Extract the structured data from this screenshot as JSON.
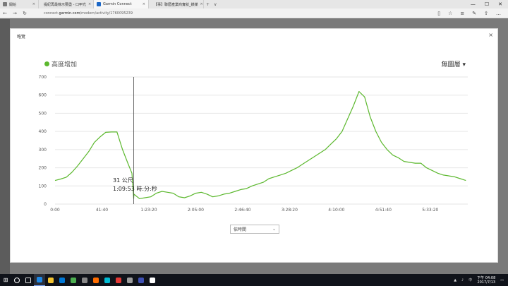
{
  "browser": {
    "tabs": [
      {
        "title": "開始",
        "color": "#7a7a7a",
        "active": false
      },
      {
        "title": "提紀再最條示要盡 - 口甲光",
        "color": "#2e9d4b",
        "active": false
      },
      {
        "title": "Garmin Connect",
        "color": "#1b67c7",
        "active": true
      },
      {
        "title": "【事】聯歷產業商實就_媒媒",
        "color": "#d9232a",
        "active": false
      }
    ],
    "new_tab": "+",
    "tab_menu": "∨",
    "url_prefix": "connect.",
    "url_domain": "garmin.com",
    "url_path": "/modern/activity/1760095239"
  },
  "modal": {
    "title": "略覽",
    "close": "×",
    "legend_label": "高度增加",
    "overlay_dropdown": "無圖層 ▾",
    "tooltip_distance": "31 公尺",
    "tooltip_time": "1:09:53 時:分:秒",
    "select_value": "依時間"
  },
  "chart_data": {
    "type": "line",
    "series": [
      {
        "name": "高度增加",
        "color": "#5cb82e",
        "x": [
          0,
          300,
          600,
          900,
          1200,
          1500,
          1800,
          2100,
          2400,
          2700,
          3000,
          3300,
          3600,
          3900,
          4100,
          4193,
          4200,
          4500,
          4800,
          5100,
          5400,
          5700,
          6000,
          6300,
          6600,
          6900,
          7200,
          7500,
          7800,
          8100,
          8400,
          8700,
          9000,
          9300,
          9600,
          9900,
          10200,
          10500,
          10800,
          11100,
          11400,
          11700,
          12000,
          12300,
          12600,
          12900,
          13200,
          13500,
          13800,
          14100,
          14400,
          14700,
          15000,
          15300,
          15600,
          15900,
          16200,
          16500,
          16800,
          17100,
          17400,
          17700,
          18000,
          18300,
          18600,
          18900,
          19200,
          19500,
          19800,
          20100,
          20400,
          20700,
          21000,
          21300,
          21600,
          21900
        ],
        "y": [
          130,
          138,
          148,
          175,
          210,
          250,
          290,
          340,
          370,
          395,
          397,
          397,
          300,
          220,
          170,
          31,
          55,
          30,
          35,
          40,
          60,
          70,
          65,
          60,
          40,
          35,
          45,
          60,
          65,
          55,
          40,
          45,
          55,
          60,
          70,
          80,
          85,
          100,
          110,
          120,
          140,
          150,
          160,
          170,
          185,
          200,
          220,
          240,
          260,
          280,
          300,
          330,
          360,
          400,
          470,
          540,
          620,
          590,
          480,
          400,
          340,
          300,
          270,
          255,
          235,
          230,
          225,
          225,
          200,
          185,
          170,
          160,
          155,
          150,
          140,
          130
        ]
      }
    ],
    "xlabel": "",
    "ylabel": "",
    "x_ticks": [
      {
        "v": 0,
        "t": "0:00"
      },
      {
        "v": 2500,
        "t": "41:40"
      },
      {
        "v": 5000,
        "t": "1:23:20"
      },
      {
        "v": 7500,
        "t": "2:05:00"
      },
      {
        "v": 10000,
        "t": "2:46:40"
      },
      {
        "v": 12500,
        "t": "3:28:20"
      },
      {
        "v": 15000,
        "t": "4:10:00"
      },
      {
        "v": 17500,
        "t": "4:51:40"
      },
      {
        "v": 20000,
        "t": "5:33:20"
      }
    ],
    "y_ticks": [
      0,
      100,
      200,
      300,
      400,
      500,
      600,
      700
    ],
    "xlim": [
      0,
      22000
    ],
    "ylim": [
      0,
      700
    ],
    "cursor_x": 4193,
    "grid": true
  },
  "taskbar": {
    "time": "下午 04:08",
    "date": "2017/7/13",
    "icons": [
      {
        "name": "search",
        "color": "#ffffff"
      },
      {
        "name": "task-view",
        "color": "#dddddd"
      },
      {
        "name": "edge",
        "color": "#1e88e5"
      },
      {
        "name": "explorer",
        "color": "#f4c430"
      },
      {
        "name": "store",
        "color": "#0078d7"
      },
      {
        "name": "chrome",
        "color": "#4caf50"
      },
      {
        "name": "app-a",
        "color": "#888888"
      },
      {
        "name": "app-b",
        "color": "#ff6d00"
      },
      {
        "name": "app-c",
        "color": "#00bcd4"
      },
      {
        "name": "app-d",
        "color": "#e53935"
      },
      {
        "name": "app-e",
        "color": "#9e9e9e"
      },
      {
        "name": "app-f",
        "color": "#3f51b5"
      },
      {
        "name": "app-g",
        "color": "#ffffff"
      }
    ]
  }
}
